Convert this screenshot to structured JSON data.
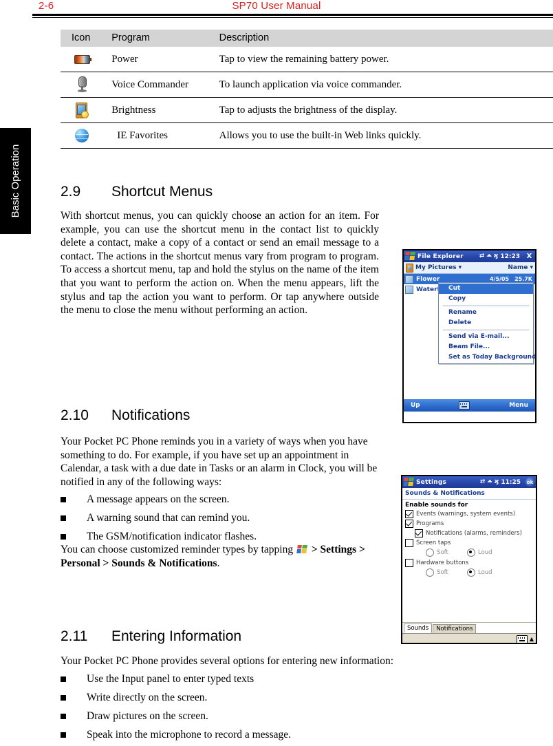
{
  "header": {
    "page_number": "2-6",
    "manual_title": "SP70 User Manual",
    "color": "#e01b1b"
  },
  "section_tab": {
    "label": "Basic Operation"
  },
  "icon_table": {
    "columns": [
      "Icon",
      "Program",
      "Description"
    ],
    "rows": [
      {
        "icon": "battery-icon",
        "program": "Power",
        "description": "Tap to view the remaining battery power."
      },
      {
        "icon": "microphone-icon",
        "program": "Voice Commander",
        "description": "To launch application via voice commander."
      },
      {
        "icon": "brightness-icon",
        "program": "Brightness",
        "description": "Tap to adjusts the brightness of the display."
      },
      {
        "icon": "globe-icon",
        "program": "IE Favorites",
        "description": "Allows you to use the built-in Web links quickly."
      }
    ]
  },
  "sections": {
    "shortcut_menus": {
      "number": "2.9",
      "title": "Shortcut Menus",
      "body": "With shortcut menus, you can quickly choose an action for an item. For example, you can use the shortcut menu in the contact list to quickly delete a contact, make a copy of a contact or send an email message to a contact. The actions in the shortcut menus vary from program to program. To access a shortcut menu, tap and hold the stylus on the name of the item that you want to perform the action on. When the menu appears, lift the stylus and tap the action you want to perform. Or tap anywhere outside the menu to close the menu without performing an action."
    },
    "notifications": {
      "number": "2.10",
      "title": "Notifications",
      "body": "Your Pocket PC Phone reminds you in a variety of ways when you have something to do. For example, if you have set up an appointment in Calendar, a task with a due date in Tasks or an alarm in Clock, you will be notified in any of the following ways:",
      "bullets": [
        "A message appears on the screen.",
        "A warning sound that can remind you.",
        "The GSM/notification indicator flashes."
      ],
      "footer_pre": "You can choose customized reminder types by tapping",
      "footer_icon": "windows-start-icon",
      "footer_path_1": "> Settings",
      "footer_path_2": "> Personal > Sounds & Notifications",
      "footer_end": "."
    },
    "entering_information": {
      "number": "2.11",
      "title": "Entering Information",
      "body": "Your Pocket PC Phone provides several options for entering new information:",
      "bullets": [
        "Use the Input panel to enter typed texts",
        "Write directly on the screen.",
        "Draw pictures on the screen.",
        "Speak into the microphone to record a message."
      ]
    }
  },
  "file_explorer": {
    "title": "File Explorer",
    "clock": "12:23",
    "status_icons": [
      "connectivity-icon",
      "signal-icon",
      "volume-icon"
    ],
    "close_label": "X",
    "folder_label": "My Pictures",
    "folder_caret": "▾",
    "sort_label": "Name",
    "sort_caret": "▾",
    "files": [
      {
        "name": "Flower",
        "date": "4/5/05",
        "size": "25.7K",
        "selected": true
      },
      {
        "name": "Waterfall",
        "date": "",
        "size": "",
        "selected": false
      }
    ],
    "context_menu": [
      {
        "label": "Cut",
        "highlighted": true
      },
      {
        "label": "Copy",
        "highlighted": false
      },
      {
        "separator": true
      },
      {
        "label": "Rename",
        "highlighted": false
      },
      {
        "label": "Delete",
        "highlighted": false
      },
      {
        "separator": true
      },
      {
        "label": "Send via E-mail...",
        "highlighted": false
      },
      {
        "label": "Beam File...",
        "highlighted": false
      },
      {
        "label": "Set as Today Background",
        "highlighted": false
      }
    ],
    "bottom_left": "Up",
    "bottom_center_icon": "keyboard-icon",
    "bottom_right": "Menu"
  },
  "settings_screen": {
    "title": "Settings",
    "clock": "11:25",
    "ok_label": "ok",
    "subtitle": "Sounds & Notifications",
    "group_label": "Enable sounds for",
    "checkboxes": [
      {
        "label": "Events (warnings, system events)",
        "checked": true,
        "indent": 0
      },
      {
        "label": "Programs",
        "checked": true,
        "indent": 0
      },
      {
        "label": "Notifications (alarms, reminders)",
        "checked": true,
        "indent": 1
      },
      {
        "label": "Screen taps",
        "checked": false,
        "indent": 0
      },
      {
        "label": "Hardware buttons",
        "checked": false,
        "indent": 0
      }
    ],
    "radio_groups": [
      {
        "soft": "Soft",
        "loud": "Loud",
        "selected": "Loud"
      },
      {
        "soft": "Soft",
        "loud": "Loud",
        "selected": "Loud"
      }
    ],
    "tabs": [
      {
        "label": "Sounds",
        "active": true
      },
      {
        "label": "Notifications",
        "active": false
      }
    ],
    "bottom_icon": "keyboard-icon",
    "bottom_arrow": "▲"
  }
}
